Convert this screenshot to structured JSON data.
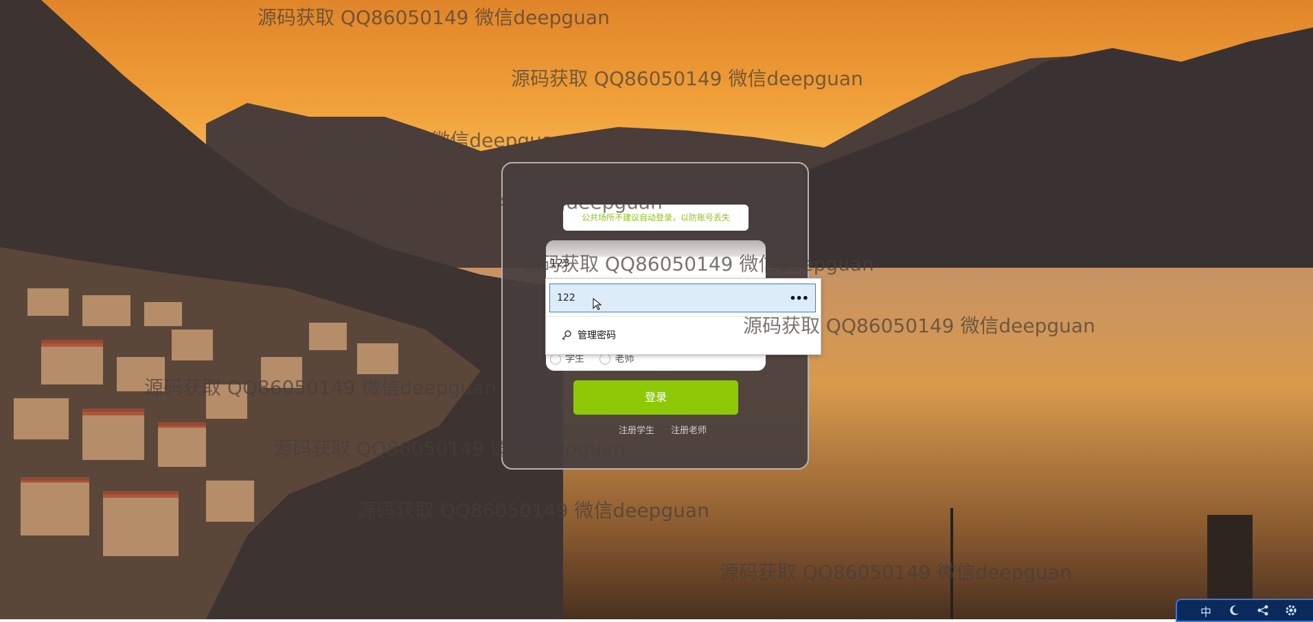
{
  "login_card": {
    "notice": "公共场所不建议自动登录，以防账号丢失",
    "username_value": "123",
    "role_options": [
      "学生",
      "老师"
    ],
    "login_label": "登录",
    "register_student": "注册学生",
    "register_teacher": "注册老师"
  },
  "password_popup": {
    "saved_entry": "122",
    "more_label": "•••",
    "manage_label": "管理密码",
    "icon": "key-icon"
  },
  "watermark": "源码获取 QQ86050149 微信deepguan",
  "tray": {
    "ime_label": "中",
    "icons": [
      "moon-icon",
      "share-icon",
      "gear-icon"
    ]
  },
  "colors": {
    "accent_green": "#8ec907",
    "notice_green": "#8ec31b",
    "highlight_blue": "#dcecf9"
  }
}
